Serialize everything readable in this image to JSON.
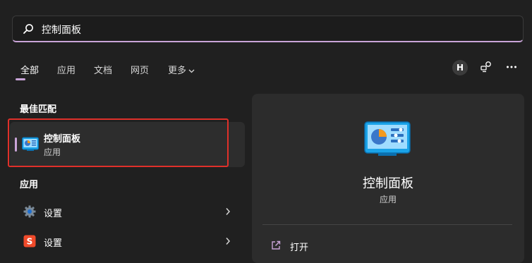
{
  "search": {
    "query": "控制面板"
  },
  "filters": {
    "tabs": [
      "全部",
      "应用",
      "文档",
      "网页",
      "更多"
    ],
    "avatar_initial": "H"
  },
  "sections": {
    "best_match": "最佳匹配",
    "apps": "应用"
  },
  "best_match": {
    "title": "控制面板",
    "subtitle": "应用"
  },
  "apps": [
    {
      "label": "设置",
      "icon": "gear-icon"
    },
    {
      "label": "设置",
      "icon": "sogou-icon"
    }
  ],
  "detail": {
    "title": "控制面板",
    "subtitle": "应用",
    "actions": [
      {
        "label": "打开",
        "icon": "open-external-icon"
      }
    ]
  },
  "colors": {
    "accent": "#c9a4d8",
    "highlight_border": "#e0302a",
    "background": "#202020",
    "panel": "#2c2c2c"
  }
}
